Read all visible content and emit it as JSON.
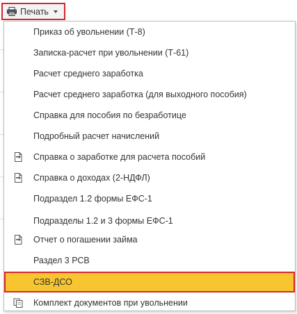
{
  "toolbar": {
    "print_label": "Печать",
    "print_icon": "printer-icon",
    "dropdown_icon": "chevron-down-icon"
  },
  "menu": {
    "items": [
      {
        "label": "Приказ об увольнении (Т-8)"
      },
      {
        "label": "Записка-расчет при увольнении (Т-61)"
      },
      {
        "label": "Расчет среднего заработка"
      },
      {
        "label": "Расчет среднего заработка (для выходного пособия)"
      },
      {
        "label": "Справка для пособия по безработице"
      },
      {
        "label": "Подробный расчет начислений"
      },
      {
        "label": "Справка о заработке для расчета пособий",
        "icon": "document-export-icon"
      },
      {
        "label": "Справка о доходах (2-НДФЛ)",
        "icon": "document-export-icon"
      },
      {
        "label": "Подраздел 1.2 формы ЕФС-1"
      },
      {
        "label": "Подразделы 1.2 и 3 формы ЕФС-1"
      },
      {
        "label": "Отчет о погашении займа",
        "icon": "document-export-icon"
      },
      {
        "label": "Раздел 3 РСВ"
      },
      {
        "label": "СЗВ-ДСО",
        "highlighted": true
      },
      {
        "label": "Комплект документов при увольнении",
        "icon": "document-set-icon"
      }
    ]
  },
  "colors": {
    "highlight": "#f6c530",
    "frame": "#d7262c"
  }
}
